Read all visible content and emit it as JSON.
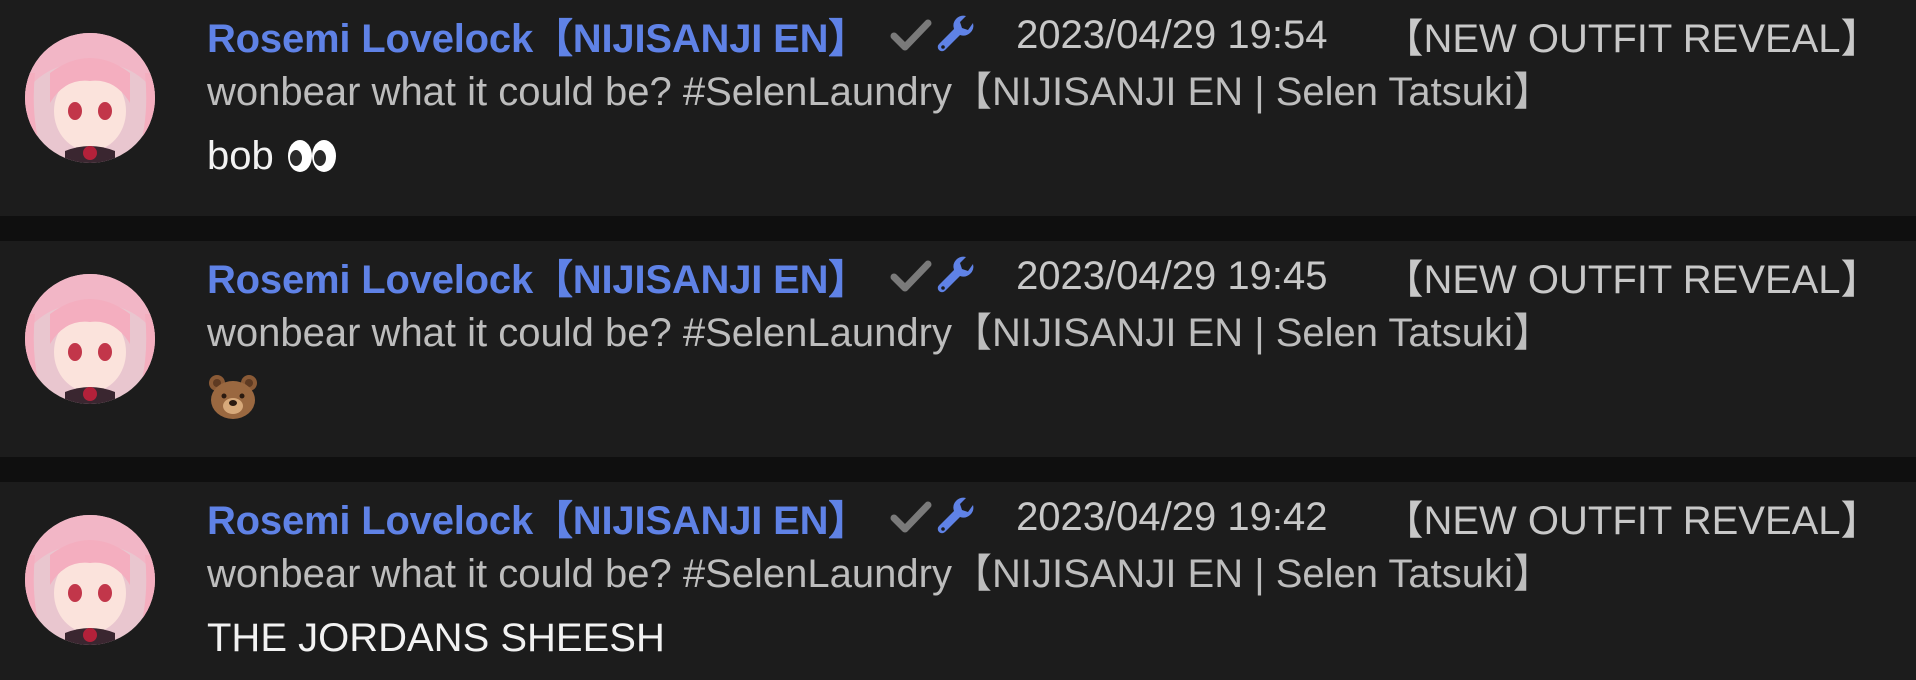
{
  "colors": {
    "background": "#1c1c1c",
    "separator": "#0f0f0f",
    "author": "#5f82e6",
    "meta_text": "#c8c8c8",
    "body_text": "#f2f2f2"
  },
  "messages": [
    {
      "author": "Rosemi Lovelock【NIJISANJI EN】",
      "badges": [
        "checkmark-icon",
        "wrench-icon"
      ],
      "timestamp": "2023/04/29 19:54",
      "stream_tag": "【NEW OUTFIT REVEAL】",
      "stream_title": "wonbear what it could be? #SelenLaundry【NIJISANJI EN | Selen Tatsuki】",
      "text": "bob",
      "emoji": "eyes-emoji"
    },
    {
      "author": "Rosemi Lovelock【NIJISANJI EN】",
      "badges": [
        "checkmark-icon",
        "wrench-icon"
      ],
      "timestamp": "2023/04/29 19:45",
      "stream_tag": "【NEW OUTFIT REVEAL】",
      "stream_title": "wonbear what it could be? #SelenLaundry【NIJISANJI EN | Selen Tatsuki】",
      "text": "",
      "emoji": "bear-emoji"
    },
    {
      "author": "Rosemi Lovelock【NIJISANJI EN】",
      "badges": [
        "checkmark-icon",
        "wrench-icon"
      ],
      "timestamp": "2023/04/29 19:42",
      "stream_tag": "【NEW OUTFIT REVEAL】",
      "stream_title": "wonbear what it could be? #SelenLaundry【NIJISANJI EN | Selen Tatsuki】",
      "text": "THE JORDANS SHEESH",
      "emoji": ""
    }
  ]
}
